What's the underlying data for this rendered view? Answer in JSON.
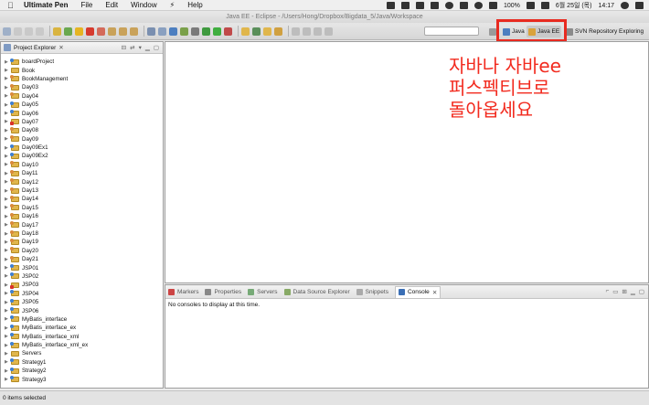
{
  "menubar": {
    "app_name": "Ultimate Pen",
    "items": [
      "File",
      "Edit",
      "Window",
      "Help"
    ],
    "battery": "100%",
    "date_time": "6월 25일 (목)",
    "clock": "14:17"
  },
  "window": {
    "title": "Java EE - Eclipse - /Users/Hong/Dropbox/Bigdata_5/Java/Workspace"
  },
  "perspectives": {
    "java_label": "Java",
    "javaee_label": "Java EE",
    "svn_label": "SVN Repository Exploring"
  },
  "explorer": {
    "tab_label": "Project Explorer",
    "close": "✕",
    "projects": [
      {
        "name": "boardProject",
        "type": "j"
      },
      {
        "name": "Book",
        "type": ""
      },
      {
        "name": "BookManagement",
        "type": "w"
      },
      {
        "name": "Day03",
        "type": "w"
      },
      {
        "name": "Day04",
        "type": "w"
      },
      {
        "name": "Day05",
        "type": "j"
      },
      {
        "name": "Day06",
        "type": "j"
      },
      {
        "name": "Day07",
        "type": "e"
      },
      {
        "name": "Day08",
        "type": "w"
      },
      {
        "name": "Day09",
        "type": "w"
      },
      {
        "name": "Day09Ex1",
        "type": "j"
      },
      {
        "name": "Day09Ex2",
        "type": "j"
      },
      {
        "name": "Day10",
        "type": "w"
      },
      {
        "name": "Day11",
        "type": "w"
      },
      {
        "name": "Day12",
        "type": "w"
      },
      {
        "name": "Day13",
        "type": "w"
      },
      {
        "name": "Day14",
        "type": "w"
      },
      {
        "name": "Day15",
        "type": "w"
      },
      {
        "name": "Day16",
        "type": "w"
      },
      {
        "name": "Day17",
        "type": "w"
      },
      {
        "name": "Day18",
        "type": "w"
      },
      {
        "name": "Day19",
        "type": "w"
      },
      {
        "name": "Day20",
        "type": "w"
      },
      {
        "name": "Day21",
        "type": "w"
      },
      {
        "name": "JSP01",
        "type": "j"
      },
      {
        "name": "JSP02",
        "type": "j"
      },
      {
        "name": "JSP03",
        "type": "e"
      },
      {
        "name": "JSP04",
        "type": "j"
      },
      {
        "name": "JSP05",
        "type": "j"
      },
      {
        "name": "JSP06",
        "type": "j"
      },
      {
        "name": "MyBatis_interface",
        "type": "j"
      },
      {
        "name": "MyBatis_interface_ex",
        "type": "j"
      },
      {
        "name": "MyBatis_interface_xml",
        "type": "j"
      },
      {
        "name": "MyBatis_interface_xml_ex",
        "type": "j"
      },
      {
        "name": "Servers",
        "type": ""
      },
      {
        "name": "Strategy1",
        "type": "j"
      },
      {
        "name": "Strategy2",
        "type": "j"
      },
      {
        "name": "Strategy3",
        "type": "j"
      }
    ]
  },
  "annotation": {
    "text": "자바나 자바ee\n퍼스펙티브로\n돌아옵세요"
  },
  "bottom_panel": {
    "tabs": [
      {
        "label": "Markers",
        "color": "#c44"
      },
      {
        "label": "Properties",
        "color": "#888"
      },
      {
        "label": "Servers",
        "color": "#7a7"
      },
      {
        "label": "Data Source Explorer",
        "color": "#8a6"
      },
      {
        "label": "Snippets",
        "color": "#aaa"
      }
    ],
    "active_tab": "Console",
    "close": "✕",
    "message": "No consoles to display at this time."
  },
  "status": {
    "text": "0 items selected"
  },
  "colors": {
    "annotation": "#f22a1e",
    "highlight_box": "#e82a20"
  }
}
